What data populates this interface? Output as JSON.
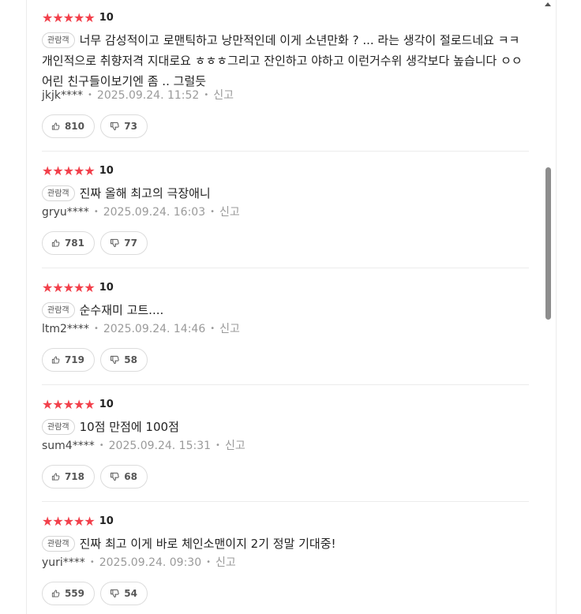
{
  "reviews": [
    {
      "stars": "★★★★★",
      "score": "10",
      "badge": "관람객",
      "text": "너무 감성적이고 로맨틱하고 낭만적인데 이게 소년만화 ? ... 라는 생각이 절로드네요 ㅋㅋ개인적으로 취향저격 지대로요 ㅎㅎㅎ그리고 잔인하고 야하고 이런거수위 생각보다 높습니다 ㅇㅇ 어린 친구들이보기엔 좀 .. 그럴듯",
      "user": "jkjk****",
      "date": "2025.09.24. 11:52",
      "report": "신고",
      "likes": "810",
      "dislikes": "73"
    },
    {
      "stars": "★★★★★",
      "score": "10",
      "badge": "관람객",
      "text": "진짜 올해 최고의 극장애니",
      "user": "gryu****",
      "date": "2025.09.24. 16:03",
      "report": "신고",
      "likes": "781",
      "dislikes": "77"
    },
    {
      "stars": "★★★★★",
      "score": "10",
      "badge": "관람객",
      "text": "순수재미 고트....",
      "user": "ltm2****",
      "date": "2025.09.24. 14:46",
      "report": "신고",
      "likes": "719",
      "dislikes": "58"
    },
    {
      "stars": "★★★★★",
      "score": "10",
      "badge": "관람객",
      "text": "10점 만점에 100점",
      "user": "sum4****",
      "date": "2025.09.24. 15:31",
      "report": "신고",
      "likes": "718",
      "dislikes": "68"
    },
    {
      "stars": "★★★★★",
      "score": "10",
      "badge": "관람객",
      "text": "진짜 최고 이게 바로 체인소맨이지 2기 정말 기대중!",
      "user": "yuri****",
      "date": "2025.09.24. 09:30",
      "report": "신고",
      "likes": "559",
      "dislikes": "54"
    }
  ],
  "colors": {
    "star": "#f2404b",
    "text": "#222222",
    "muted": "#9a9a9a",
    "border": "#ececec"
  }
}
